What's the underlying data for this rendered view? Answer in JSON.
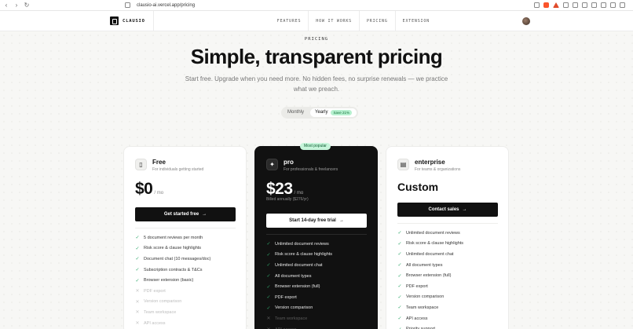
{
  "browser": {
    "url": "clausio-ai.vercel.app/pricing"
  },
  "header": {
    "logo": "CLAUSIO",
    "nav": [
      "FEATURES",
      "HOW IT WORKS",
      "PRICING",
      "EXTENSION"
    ]
  },
  "hero": {
    "eyebrow": "PRICING",
    "title": "Simple, transparent pricing",
    "subtitle": "Start free. Upgrade when you need more. No hidden fees, no surprise renewals — we practice what we preach."
  },
  "billing_toggle": {
    "monthly": "Monthly",
    "yearly": "Yearly",
    "save_badge": "Save 21%",
    "selected": "Yearly"
  },
  "plans": {
    "free": {
      "name": "Free",
      "desc": "For individuals getting started",
      "price": "$0",
      "unit": "/ mo",
      "cta": "Get started free",
      "features": [
        {
          "label": "5 document reviews per month",
          "included": true
        },
        {
          "label": "Risk score & clause highlights",
          "included": true
        },
        {
          "label": "Document chat (10 messages/doc)",
          "included": true
        },
        {
          "label": "Subscription contracts & T&Cs",
          "included": true
        },
        {
          "label": "Browser extension (basic)",
          "included": true
        },
        {
          "label": "PDF export",
          "included": false
        },
        {
          "label": "Version comparison",
          "included": false
        },
        {
          "label": "Team workspace",
          "included": false
        },
        {
          "label": "API access",
          "included": false
        }
      ]
    },
    "pro": {
      "badge": "Most popular",
      "name": "pro",
      "desc": "For professionals & freelancers",
      "price": "$23",
      "unit": "/ mo",
      "billed": "Billed annually ($276/yr)",
      "cta": "Start 14-day free trial",
      "features": [
        {
          "label": "Unlimited document reviews",
          "included": true
        },
        {
          "label": "Risk score & clause highlights",
          "included": true
        },
        {
          "label": "Unlimited document chat",
          "included": true
        },
        {
          "label": "All document types",
          "included": true
        },
        {
          "label": "Browser extension (full)",
          "included": true
        },
        {
          "label": "PDF export",
          "included": true
        },
        {
          "label": "Version comparison",
          "included": true
        },
        {
          "label": "Team workspace",
          "included": false
        },
        {
          "label": "API access",
          "included": false
        }
      ]
    },
    "enterprise": {
      "name": "enterprise",
      "desc": "For teams & organizations",
      "price": "Custom",
      "cta": "Contact sales",
      "features": [
        {
          "label": "Unlimited document reviews",
          "included": true
        },
        {
          "label": "Risk score & clause highlights",
          "included": true
        },
        {
          "label": "Unlimited document chat",
          "included": true
        },
        {
          "label": "All document types",
          "included": true
        },
        {
          "label": "Browser extension (full)",
          "included": true
        },
        {
          "label": "PDF export",
          "included": true
        },
        {
          "label": "Version comparison",
          "included": true
        },
        {
          "label": "Team workspace",
          "included": true
        },
        {
          "label": "API access",
          "included": true
        },
        {
          "label": "Priority support",
          "included": true
        }
      ]
    }
  },
  "colors": {
    "accent_green": "#2fa86a",
    "dark_card": "#111111",
    "badge_green": "#c6f4da"
  }
}
